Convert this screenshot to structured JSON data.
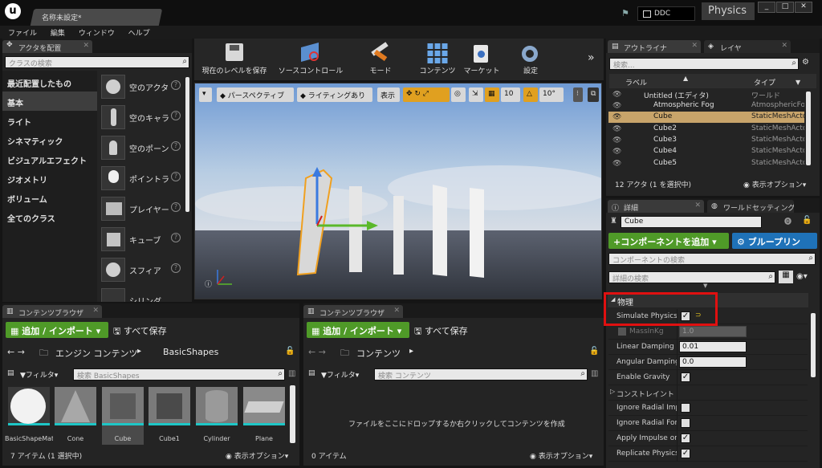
{
  "window": {
    "logo": "u",
    "tab_title": "名称未設定*",
    "ddc_label": "DDC",
    "search_placeholder": "Physics",
    "controls": [
      "_",
      "□",
      "✕"
    ]
  },
  "menu": [
    "ファイル",
    "編集",
    "ウィンドウ",
    "ヘルプ"
  ],
  "place_actors": {
    "tab": "アクタを配置",
    "search_placeholder": "クラスの検索",
    "categories": [
      "最近配置したもの",
      "基本",
      "ライト",
      "シネマティック",
      "ビジュアルエフェクト",
      "ジオメトリ",
      "ボリューム",
      "全てのクラス"
    ],
    "selected_category": "基本",
    "actors": [
      "空のアクタ",
      "空のキャラ",
      "空のポーン",
      "ポイントラ",
      "プレイヤー",
      "キューブ",
      "スフィア",
      "シリンダ"
    ]
  },
  "toolbar": [
    {
      "label": "現在のレベルを保存",
      "icon": "floppy-icon"
    },
    {
      "label": "ソースコントロール",
      "icon": "source-control-icon"
    },
    {
      "label": "モード",
      "icon": "modes-icon"
    },
    {
      "label": "コンテンツ",
      "icon": "content-icon"
    },
    {
      "label": "マーケット",
      "icon": "marketplace-icon"
    },
    {
      "label": "設定",
      "icon": "settings-icon"
    }
  ],
  "viewport": {
    "perspective": "パースペクティブ",
    "lighting": "ライティングあり",
    "show": "表示",
    "grid_snap": "10",
    "rot_snap": "10°"
  },
  "outliner": {
    "tabs": [
      "アウトライナ",
      "レイヤ"
    ],
    "search_placeholder": "検索...",
    "col_label": "ラベル",
    "col_type": "タイプ",
    "rows": [
      {
        "name": "Untitled (エディタ)",
        "type": "ワールド"
      },
      {
        "name": "Atmospheric Fog",
        "type": "AtmosphericFog"
      },
      {
        "name": "Cube",
        "type": "StaticMeshActor",
        "selected": true
      },
      {
        "name": "Cube2",
        "type": "StaticMeshActor"
      },
      {
        "name": "Cube3",
        "type": "StaticMeshActor"
      },
      {
        "name": "Cube4",
        "type": "StaticMeshActor"
      },
      {
        "name": "Cube5",
        "type": "StaticMeshActor"
      }
    ],
    "status": "12 アクタ (1 を選択中)",
    "view_options": "表示オプション"
  },
  "details": {
    "tabs": [
      "詳細",
      "ワールドセッティング"
    ],
    "name": "Cube",
    "add_component": "+コンポーネントを追加",
    "blueprint": "ブループリン",
    "component_search": "コンポーネントの検索",
    "detail_search": "詳細の検索",
    "section": "物理",
    "props": [
      {
        "label": "Simulate Physics",
        "kind": "check",
        "value": "✓"
      },
      {
        "label": "MassInKg",
        "kind": "num",
        "value": "1.0"
      },
      {
        "label": "Linear Damping",
        "kind": "num",
        "value": "0.01"
      },
      {
        "label": "Angular Damping",
        "kind": "num",
        "value": "0.0"
      },
      {
        "label": "Enable Gravity",
        "kind": "check",
        "value": "✓"
      },
      {
        "label": "コンストレイント",
        "kind": "section",
        "value": ""
      },
      {
        "label": "Ignore Radial Impulse",
        "kind": "check",
        "value": ""
      },
      {
        "label": "Ignore Radial Force",
        "kind": "check",
        "value": ""
      },
      {
        "label": "Apply Impulse on Damage",
        "kind": "check",
        "value": "✓"
      },
      {
        "label": "Replicate Physics",
        "kind": "check",
        "value": "✓"
      }
    ]
  },
  "content_browser_left": {
    "tab": "コンテンツブラウザ",
    "add_import": "追加 / インポート",
    "save_all": "すべて保存",
    "path": [
      "エンジン コンテンツ",
      "BasicShapes"
    ],
    "filter": "フィルタ",
    "search_placeholder": "検索 BasicShapes",
    "assets": [
      "BasicShapeMaterial",
      "Cone",
      "Cube",
      "Cube1",
      "Cylinder",
      "Plane"
    ],
    "status": "7 アイテム (1 選択中)",
    "view_options": "表示オプション"
  },
  "content_browser_right": {
    "tab": "コンテンツブラウザ",
    "add_import": "追加 / インポート",
    "save_all": "すべて保存",
    "path": [
      "コンテンツ"
    ],
    "filter": "フィルタ",
    "search_placeholder": "検索 コンテンツ",
    "drop_hint": "ファイルをここにドロップするか右クリックしてコンテンツを作成",
    "status": "0 アイテム",
    "view_options": "表示オプション"
  },
  "colors": {
    "accent_green": "#4f9a28",
    "accent_blue": "#1f72b8",
    "highlight_red": "#e01010",
    "selection": "#c8a46a"
  }
}
